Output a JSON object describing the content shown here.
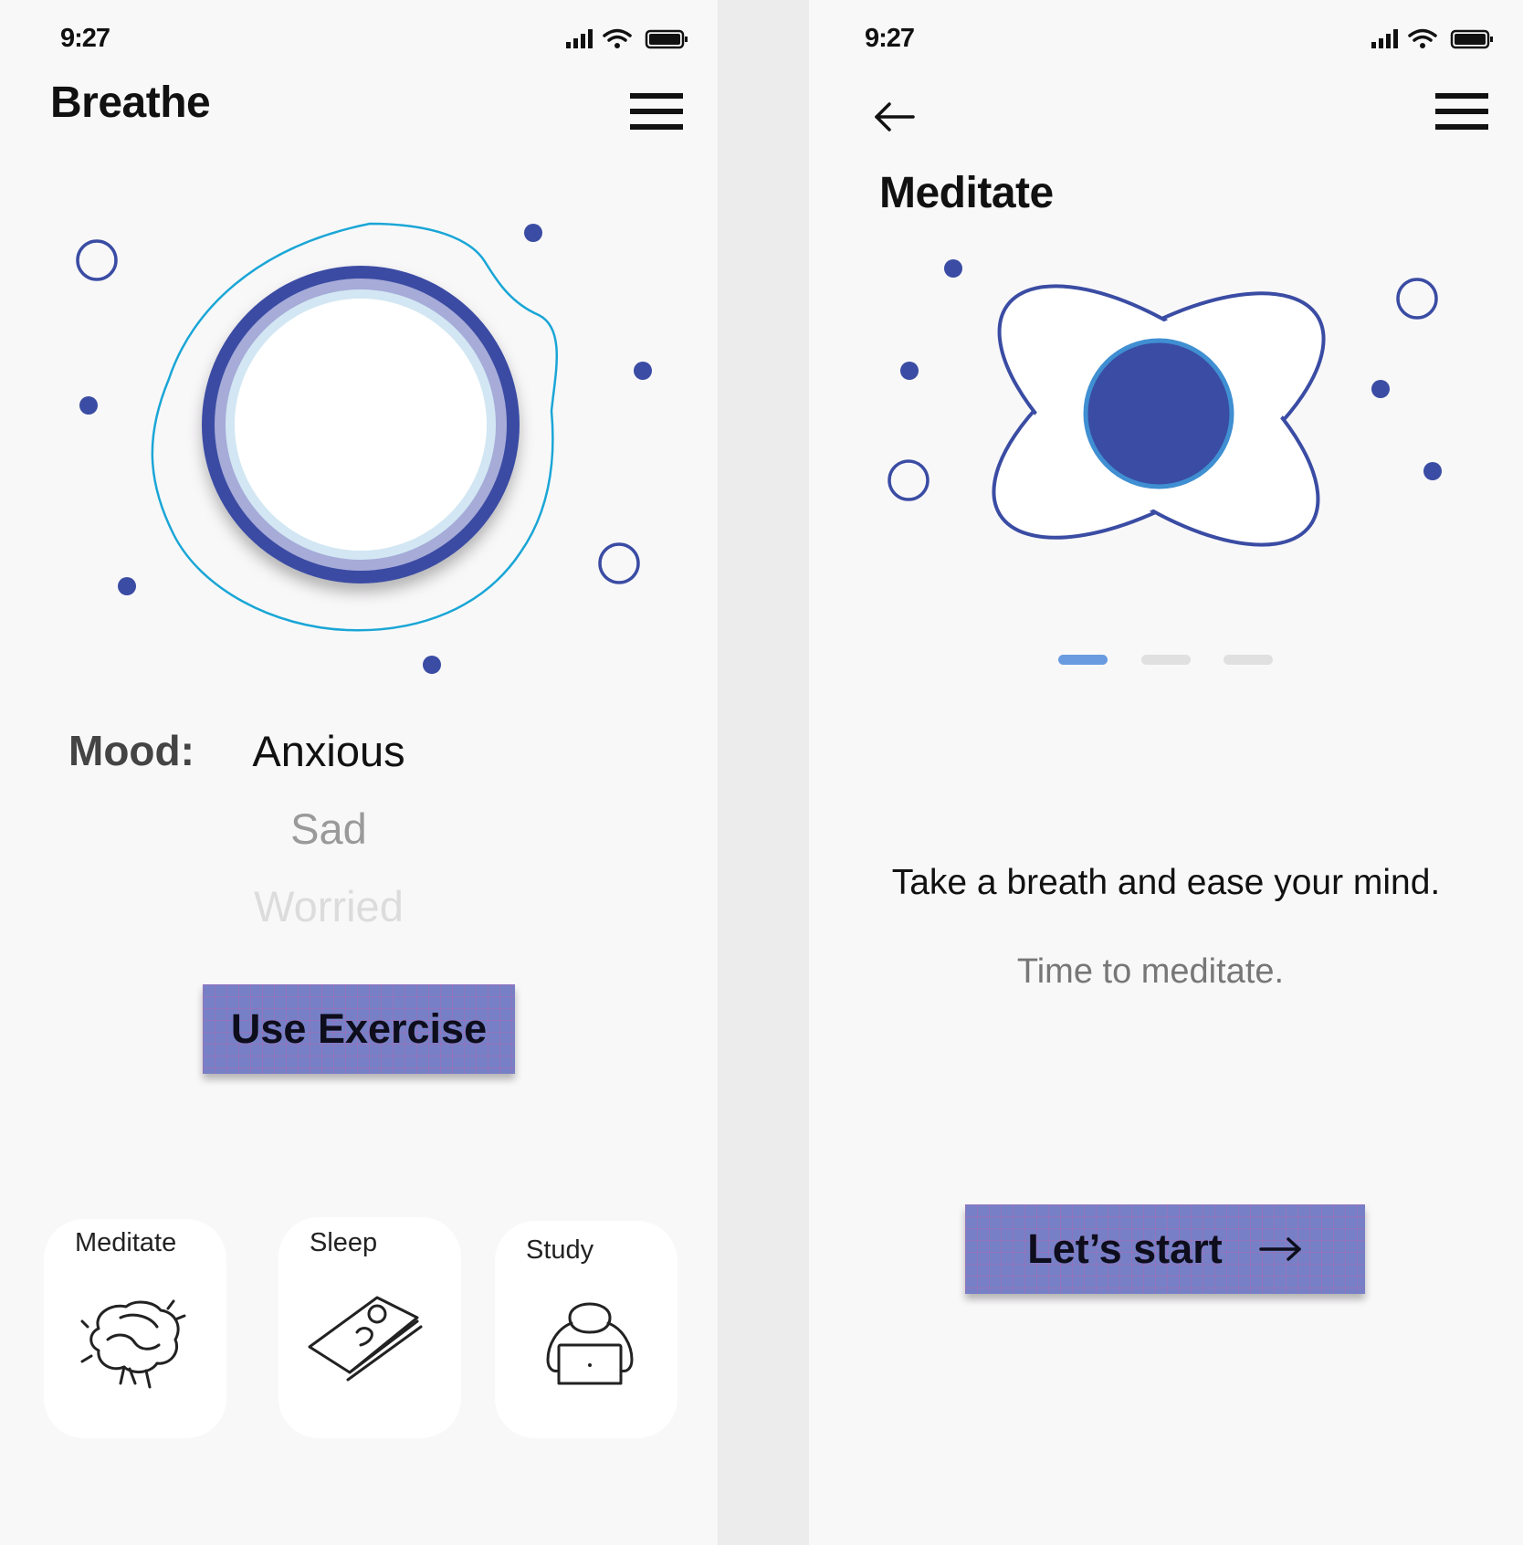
{
  "left_screen": {
    "status": {
      "time": "9:27"
    },
    "app_title": "Breathe",
    "mood": {
      "label": "Mood:",
      "options": [
        "Anxious",
        "Sad",
        "Worried"
      ]
    },
    "exercise_button_label": "Use Exercise",
    "categories": [
      {
        "label": "Meditate",
        "icon": "brain-icon"
      },
      {
        "label": "Sleep",
        "icon": "sleeping-person-icon"
      },
      {
        "label": "Study",
        "icon": "person-laptop-icon"
      }
    ]
  },
  "right_screen": {
    "status": {
      "time": "9:27"
    },
    "page_title": "Meditate",
    "carousel": {
      "count": 3,
      "active": 0
    },
    "tagline": "Take a breath and ease your mind.",
    "subtitle": "Time to meditate.",
    "start_button_label": "Let’s start"
  },
  "colors": {
    "accent_dark": "#3a4ca3",
    "accent_light": "#a6abd8",
    "button_fill": "#7780c6",
    "outline_cyan": "#1aa6d6",
    "active_dot": "#6a9be0",
    "inactive_dot": "#e0e0e0",
    "screen_bg": "#f9f8f9"
  }
}
